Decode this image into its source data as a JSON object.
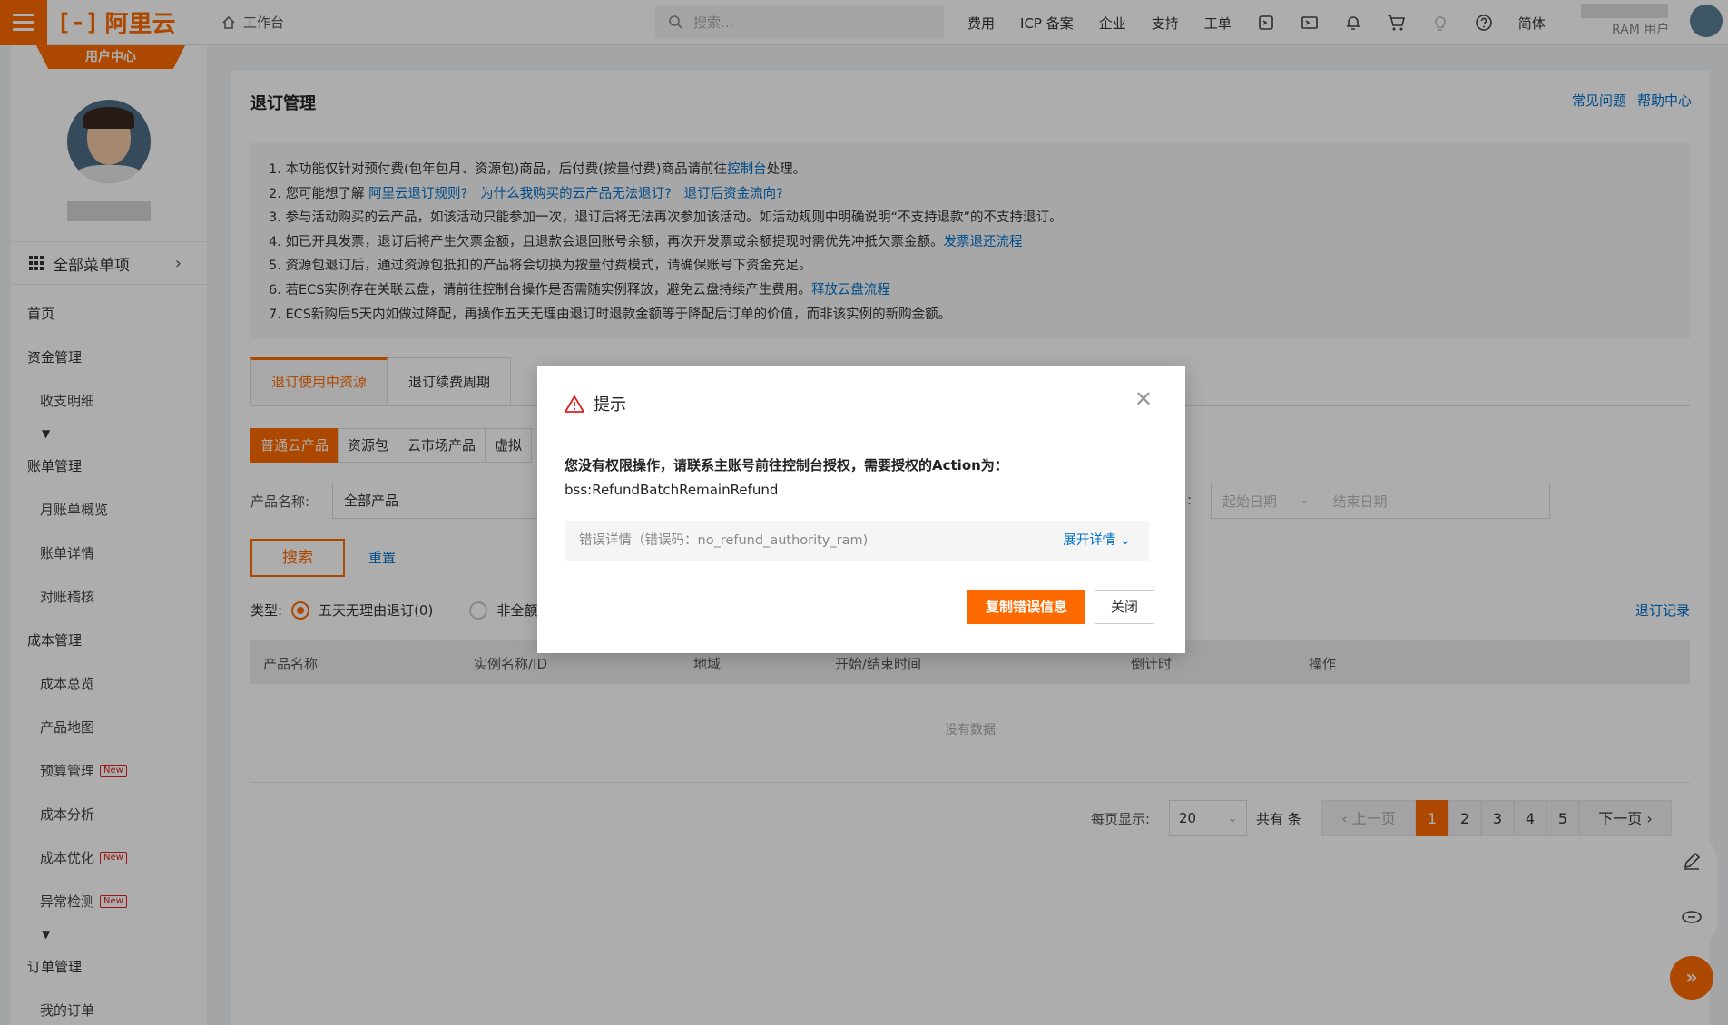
{
  "topbar": {
    "logo_text": "阿里云",
    "logo_sub": "用户中心",
    "workbench": "工作台",
    "search_placeholder": "搜索...",
    "nav": [
      "费用",
      "ICP 备案",
      "企业",
      "支持",
      "工单"
    ],
    "lang": "简体",
    "ram_user": "RAM 用户"
  },
  "sidebar": {
    "all_menu": "全部菜单项",
    "items": [
      {
        "label": "首页",
        "level": 0
      },
      {
        "label": "资金管理",
        "level": 0
      },
      {
        "label": "收支明细",
        "level": 1
      },
      {
        "label": "▼",
        "level": 2
      },
      {
        "label": "账单管理",
        "level": 0
      },
      {
        "label": "月账单概览",
        "level": 1
      },
      {
        "label": "账单详情",
        "level": 1
      },
      {
        "label": "对账稽核",
        "level": 1
      },
      {
        "label": "成本管理",
        "level": 0
      },
      {
        "label": "成本总览",
        "level": 1
      },
      {
        "label": "产品地图",
        "level": 1
      },
      {
        "label": "预算管理",
        "level": 1,
        "badge": "New"
      },
      {
        "label": "成本分析",
        "level": 1
      },
      {
        "label": "成本优化",
        "level": 1,
        "badge": "New"
      },
      {
        "label": "异常检测",
        "level": 1,
        "badge": "New"
      },
      {
        "label": "▼",
        "level": 2
      },
      {
        "label": "订单管理",
        "level": 0
      },
      {
        "label": "我的订单",
        "level": 1
      }
    ]
  },
  "main": {
    "title": "退订管理",
    "help_links": [
      "常见问题",
      "帮助中心"
    ],
    "notice": {
      "l1a": "1. 本功能仅针对预付费(包年包月、资源包)商品，后付费(按量付费)商品请前往",
      "l1link": "控制台",
      "l1b": "处理。",
      "l2a": "2. 您可能想了解 ",
      "l2link1": "阿里云退订规则?",
      "l2link2": "为什么我购买的云产品无法退订?",
      "l2link3": "退订后资金流向?",
      "l3": "3. 参与活动购买的云产品，如该活动只能参加一次，退订后将无法再次参加该活动。如活动规则中明确说明“不支持退款”的不支持退订。",
      "l4a": "4. 如已开具发票，退订后将产生欠票金额，且退款会退回账号余额，再次开发票或余额提现时需优先冲抵欠票金额。",
      "l4link": "发票退还流程",
      "l5": "5. 资源包退订后，通过资源包抵扣的产品将会切换为按量付费模式，请确保账号下资金充足。",
      "l6a": "6. 若ECS实例存在关联云盘，请前往控制台操作是否需随实例释放，避免云盘持续产生费用。",
      "l6link": "释放云盘流程",
      "l7": "7. ECS新购后5天内如做过降配，再操作五天无理由退订时退款金额等于降配后订单的价值，而非该实例的新购金额。"
    },
    "tabs": [
      "退订使用中资源",
      "退订续费周期"
    ],
    "subtabs": [
      "普通云产品",
      "资源包",
      "云市场产品",
      "虚拟"
    ],
    "product_label": "产品名称:",
    "product_value": "全部产品",
    "date_start": "起始日期",
    "date_end": "结束日期",
    "search_btn": "搜索",
    "reset": "重置",
    "type_label": "类型:",
    "type_opt1": "五天无理由退订(0)",
    "type_opt2": "非全额",
    "refund_record": "退订记录",
    "columns": [
      "产品名称",
      "实例名称/ID",
      "地域",
      "开始/结束时间",
      "倒计时",
      "操作"
    ],
    "no_data": "没有数据",
    "pager": {
      "per_page_label": "每页显示:",
      "per_page": "20",
      "total": "共有 条",
      "prev": "上一页",
      "next": "下一页",
      "pages": [
        "1",
        "2",
        "3",
        "4",
        "5"
      ]
    }
  },
  "modal": {
    "title": "提示",
    "message": "您没有权限操作，请联系主账号前往控制台授权，需要授权的Action为：",
    "action": "bss:RefundBatchRemainRefund",
    "error_detail": "错误详情（错误码：no_refund_authority_ram)",
    "expand": "展开详情",
    "copy_btn": "复制错误信息",
    "close_btn": "关闭"
  },
  "colors": {
    "accent": "#ff6a00",
    "link": "#0070cc"
  }
}
